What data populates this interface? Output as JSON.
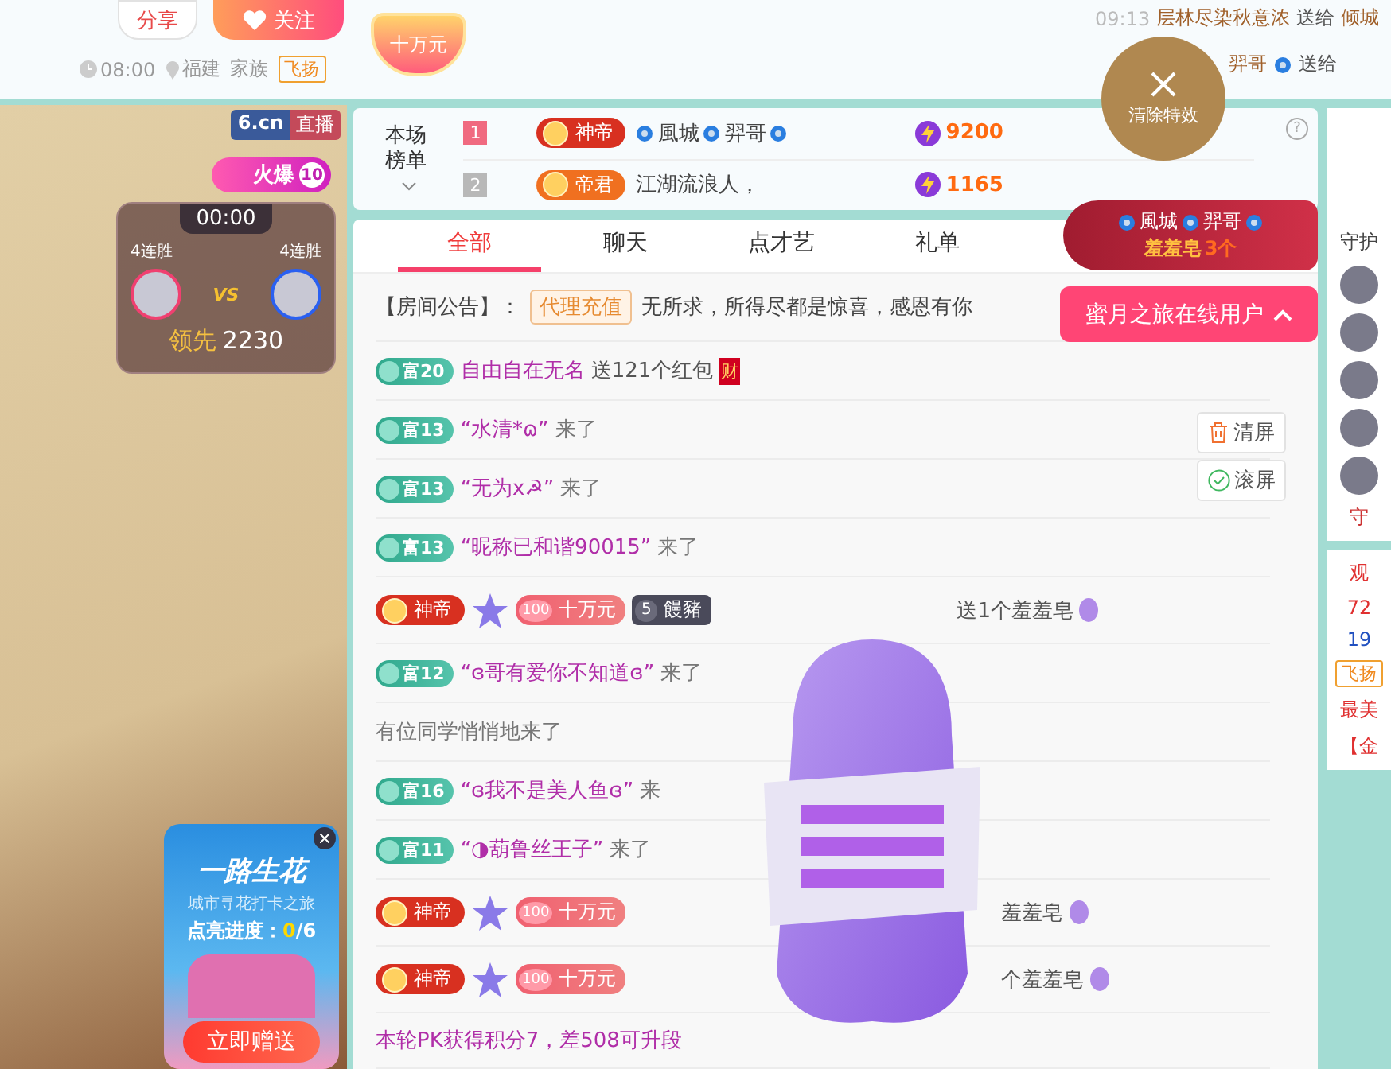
{
  "header": {
    "share": "分享",
    "follow": "关注",
    "gift_badge": "十万元",
    "time": "08:00",
    "location": "福建",
    "family_label": "家族",
    "family_tag": "飞扬",
    "feed": [
      {
        "time": "09:13",
        "sender": "层林尽染秋意浓",
        "verb": "送给",
        "receiver": "倾城"
      },
      {
        "sender": "羿哥",
        "verb": "送给"
      }
    ]
  },
  "clear_effects": "清除特效",
  "video": {
    "site": "6.cn",
    "live": "直播",
    "heat": "火爆",
    "heat_level": "10",
    "pk": {
      "timer": "00:00",
      "left_streak": "4连胜",
      "right_streak": "4连胜",
      "vs": "VS",
      "lead_label": "领先",
      "lead_value": "2230"
    },
    "activity": {
      "title": "一路生花",
      "subtitle": "城市寻花打卡之旅",
      "progress_label": "点亮进度：",
      "progress_done": "0",
      "progress_total": "/6",
      "cta": "立即赠送"
    }
  },
  "ranking": {
    "title": "本场榜单",
    "help": "?",
    "rows": [
      {
        "rank": "1",
        "badge": "神帝",
        "color": "#d83020",
        "names": [
          "風城",
          "羿哥"
        ],
        "decorated": true,
        "score": "9200"
      },
      {
        "rank": "2",
        "badge": "帝君",
        "color": "#f07020",
        "names": [
          "江湖流浪人，"
        ],
        "decorated": false,
        "score": "1165"
      }
    ]
  },
  "gift_banner": {
    "names": [
      "風城",
      "羿哥"
    ],
    "gift": "羞羞皂",
    "count": "3个"
  },
  "online_users": "蜜月之旅在线用户",
  "tabs": [
    {
      "label": "全部",
      "selected": true
    },
    {
      "label": "聊天",
      "selected": false
    },
    {
      "label": "点才艺",
      "selected": false
    },
    {
      "label": "礼单",
      "selected": false
    }
  ],
  "announcement": {
    "label": "【房间公告】：",
    "tag": "代理充值",
    "text": "无所求，所得尽都是惊喜，感恩有你"
  },
  "tools": [
    {
      "kind": "trash",
      "label": "清屏"
    },
    {
      "kind": "check",
      "label": "滚屏"
    }
  ],
  "messages": [
    {
      "kind": "redpacket",
      "level": "富20",
      "name": "自由自在无名",
      "text": "送121个红包",
      "packet": "财"
    },
    {
      "kind": "enter",
      "level": "富13",
      "name": "“水清*ɷ”",
      "text": "来了"
    },
    {
      "kind": "enter",
      "level": "富13",
      "name": "“无为x☭”",
      "text": "来了"
    },
    {
      "kind": "enter",
      "level": "富13",
      "name": "“昵称已和谐90015”",
      "text": "来了"
    },
    {
      "kind": "gift",
      "badge": "神帝",
      "hearts": "100",
      "heart_label": "十万元",
      "rank_num": "5",
      "rank_name": "饅豬",
      "text": "送1个羞羞皂"
    },
    {
      "kind": "enter",
      "level": "富12",
      "name": "“ɞ哥有爱你不知道ɞ”",
      "text": "来了"
    },
    {
      "kind": "plain",
      "text": "有位同学悄悄地来了"
    },
    {
      "kind": "enter",
      "level": "富16",
      "name": "“ɞ我不是美人鱼ɞ”",
      "text": "来"
    },
    {
      "kind": "enter",
      "level": "富11",
      "name": "“◑葫鲁丝王子”",
      "text": "来了"
    },
    {
      "kind": "gift",
      "badge": "神帝",
      "hearts": "100",
      "heart_label": "十万元",
      "text": "羞羞皂"
    },
    {
      "kind": "gift",
      "badge": "神帝",
      "hearts": "100",
      "heart_label": "十万元",
      "text": "个羞羞皂"
    },
    {
      "kind": "system",
      "text": "本轮PK获得积分7，差508可升段"
    }
  ],
  "side": {
    "tab": "守护",
    "more": "守",
    "watch": "观",
    "watch_count": "72",
    "rank": "19",
    "rank_tag": "飞扬",
    "notes": [
      "最美",
      "【金"
    ]
  }
}
